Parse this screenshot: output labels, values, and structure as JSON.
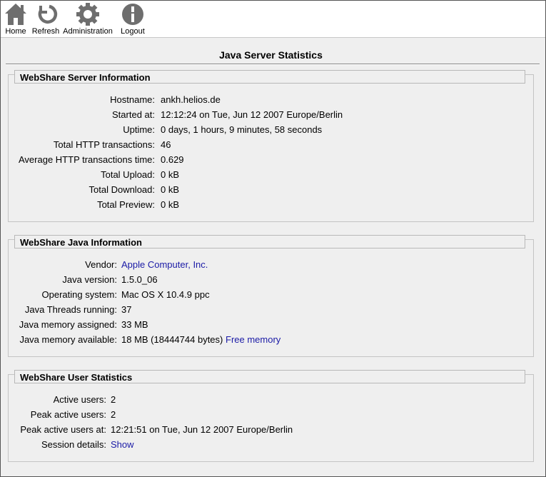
{
  "toolbar": {
    "home": "Home",
    "refresh": "Refresh",
    "administration": "Administration",
    "logout": "Logout"
  },
  "page_title": "Java Server Statistics",
  "server_info": {
    "heading": "WebShare Server Information",
    "rows": [
      {
        "label": "Hostname:",
        "value": "ankh.helios.de"
      },
      {
        "label": "Started at:",
        "value": "12:12:24 on Tue, Jun 12 2007 Europe/Berlin"
      },
      {
        "label": "Uptime:",
        "value": "0 days, 1 hours, 9 minutes, 58 seconds"
      },
      {
        "label": "Total HTTP transactions:",
        "value": "46"
      },
      {
        "label": "Average HTTP transactions time:",
        "value": "0.629"
      },
      {
        "label": "Total Upload:",
        "value": "0 kB"
      },
      {
        "label": "Total Download:",
        "value": "0 kB"
      },
      {
        "label": "Total Preview:",
        "value": "0 kB"
      }
    ]
  },
  "java_info": {
    "heading": "WebShare Java Information",
    "vendor_label": "Vendor:",
    "vendor_value": "Apple Computer, Inc.",
    "version_label": "Java version:",
    "version_value": "1.5.0_06",
    "os_label": "Operating system:",
    "os_value": "Mac OS X 10.4.9 ppc",
    "threads_label": "Java Threads running:",
    "threads_value": "37",
    "mem_assigned_label": "Java memory assigned:",
    "mem_assigned_value": "33 MB",
    "mem_available_label": "Java memory available:",
    "mem_available_value": "18 MB (18444744 bytes)",
    "free_memory_link": "Free memory"
  },
  "user_stats": {
    "heading": "WebShare User Statistics",
    "active_label": "Active users:",
    "active_value": "2",
    "peak_label": "Peak active users:",
    "peak_value": "2",
    "peak_at_label": "Peak active users at:",
    "peak_at_value": "12:21:51 on Tue, Jun 12 2007 Europe/Berlin",
    "session_label": "Session details:",
    "session_link": "Show"
  },
  "colors": {
    "link": "#1a1aa6",
    "background": "#efefef",
    "icon": "#6e6e6e"
  }
}
